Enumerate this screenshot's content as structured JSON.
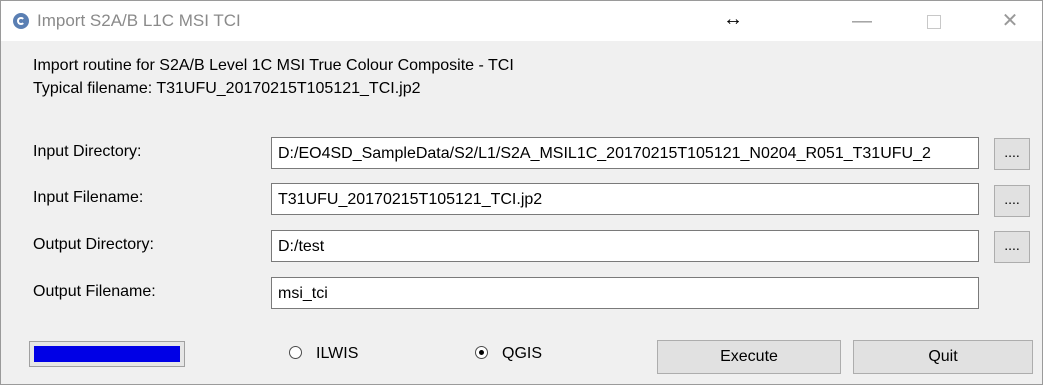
{
  "window": {
    "title": "Import S2A/B L1C MSI TCI",
    "resize_glyph": "↔",
    "minimize_glyph": "—",
    "close_glyph": "✕"
  },
  "description": {
    "line1": "Import routine for S2A/B Level 1C MSI True Colour Composite - TCI",
    "line2": "Typical filename: T31UFU_20170215T105121_TCI.jp2"
  },
  "fields": {
    "input_directory": {
      "label": "Input Directory:",
      "value": "D:/EO4SD_SampleData/S2/L1/S2A_MSIL1C_20170215T105121_N0204_R051_T31UFU_2"
    },
    "input_filename": {
      "label": "Input Filename:",
      "value": "T31UFU_20170215T105121_TCI.jp2"
    },
    "output_directory": {
      "label": "Output Directory:",
      "value": "D:/test"
    },
    "output_filename": {
      "label": "Output Filename:",
      "value": "msi_tci"
    }
  },
  "browse_label": "....",
  "progress": {
    "fraction": 1.0,
    "color": "#0000e6"
  },
  "radio": {
    "ilwis_label": "ILWIS",
    "qgis_label": "QGIS",
    "selected": "QGIS"
  },
  "buttons": {
    "execute_label": "Execute",
    "quit_label": "Quit"
  }
}
